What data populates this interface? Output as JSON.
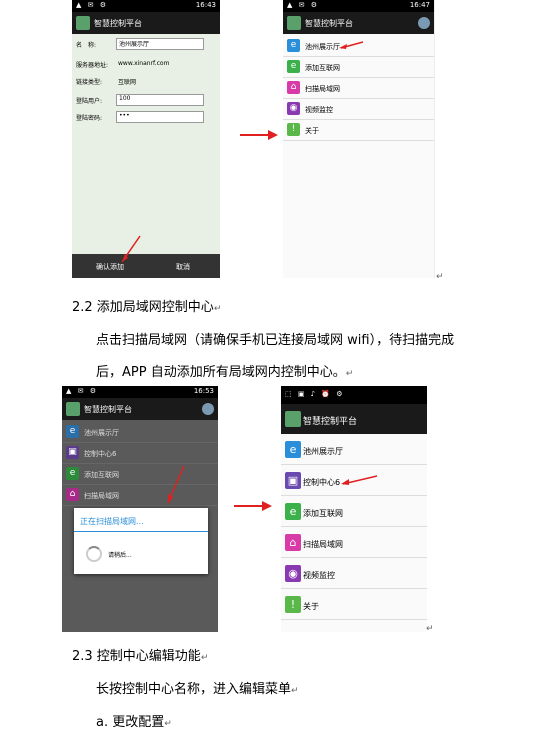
{
  "screens": {
    "form": {
      "status_time": "16:43",
      "title": "智慧控制平台",
      "fields": [
        {
          "label": "名　称:",
          "value": "池州展示厅"
        },
        {
          "label": "服务器地址:",
          "value": "www.xinanrf.com"
        },
        {
          "label": "链接类型:",
          "value": "互联网"
        },
        {
          "label": "登陆用户:",
          "value": "100"
        },
        {
          "label": "登陆密码:",
          "value": "•••"
        }
      ],
      "confirm_button": "确认添加",
      "cancel_button": "取消"
    },
    "menu1": {
      "status_time": "16:47",
      "title": "智慧控制平台",
      "items": [
        "池州展示厅",
        "添加互联网",
        "扫描局域网",
        "视频监控",
        "关于"
      ]
    },
    "scan": {
      "status_time": "16:53",
      "title": "智慧控制平台",
      "items": [
        "池州展示厅",
        "控制中心6",
        "添加互联网",
        "扫描局域网"
      ],
      "dialog_title": "正在扫描局域网...",
      "dialog_msg": "请稍后..."
    },
    "menu2": {
      "title": "智慧控制平台",
      "items": [
        "池州展示厅",
        "控制中心6",
        "添加互联网",
        "扫描局域网",
        "视频监控",
        "关于"
      ]
    }
  },
  "doc": {
    "sec22": "2.2  添加局域网控制中心",
    "p1": "点击扫描局域网（请确保手机已连接局域网 wifi），待扫描完成",
    "p2": "后，APP 自动添加所有局域网内控制中心。",
    "sec23": "2.3  控制中心编辑功能",
    "p3": "长按控制中心名称，进入编辑菜单",
    "item_a": "a.  更改配置"
  }
}
